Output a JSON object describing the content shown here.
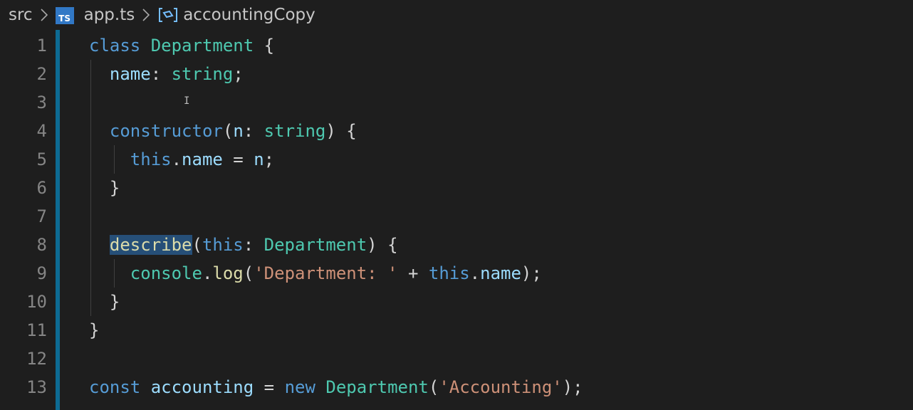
{
  "breadcrumb": {
    "folder": "src",
    "file_icon_label": "TS",
    "file": "app.ts",
    "symbol": "accountingCopy"
  },
  "editor": {
    "line_numbers": [
      "1",
      "2",
      "3",
      "4",
      "5",
      "6",
      "7",
      "8",
      "9",
      "10",
      "11",
      "12",
      "13"
    ],
    "lines": {
      "l1": {
        "kw": "class",
        "type": "Department",
        "punc": "{"
      },
      "l2": {
        "prop": "name",
        "punc": ":",
        "type": "string",
        "end": ";"
      },
      "l4": {
        "fn": "constructor",
        "open": "(",
        "param": "n",
        "colon": ":",
        "type": "string",
        "close": ")",
        "brace": "{"
      },
      "l5": {
        "this": "this",
        "dot": ".",
        "prop": "name",
        "eq": "=",
        "val": "n",
        "end": ";"
      },
      "l6": {
        "punc": "}"
      },
      "l8": {
        "fn": "describe",
        "open": "(",
        "this": "this",
        "colon": ":",
        "type": "Department",
        "close": ")",
        "brace": "{"
      },
      "l9": {
        "obj": "console",
        "dot": ".",
        "fn": "log",
        "open": "(",
        "str": "'Department: '",
        "plus": "+",
        "this": "this",
        "dot2": ".",
        "prop": "name",
        "close": ");"
      },
      "l10": {
        "punc": "}"
      },
      "l11": {
        "punc": "}"
      },
      "l13": {
        "kw": "const",
        "var": "accounting",
        "eq": "=",
        "new": "new",
        "type": "Department",
        "open": "(",
        "str": "'Accounting'",
        "close": ");"
      }
    }
  },
  "colors": {
    "background": "#1e1e1e",
    "keyword": "#569cd6",
    "type": "#4ec9b0",
    "property": "#9cdcfe",
    "function": "#dcdcaa",
    "string": "#ce9178",
    "accent": "#0d6b94"
  }
}
